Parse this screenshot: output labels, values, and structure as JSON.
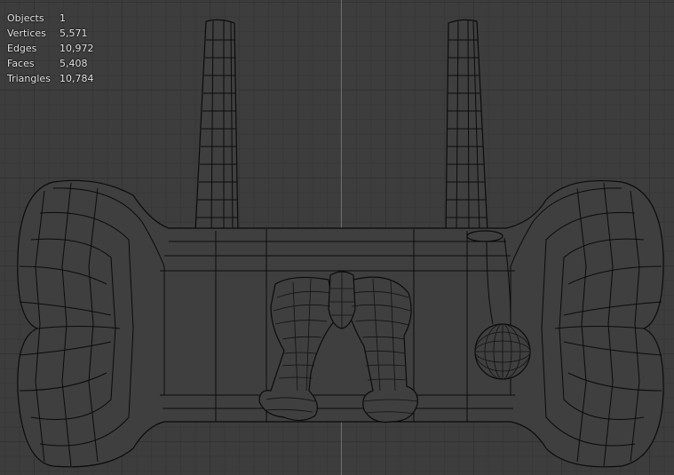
{
  "stats": [
    {
      "label": "Objects",
      "value": "1"
    },
    {
      "label": "Vertices",
      "value": "5,571"
    },
    {
      "label": "Edges",
      "value": "10,972"
    },
    {
      "label": "Faces",
      "value": "5,408"
    },
    {
      "label": "Triangles",
      "value": "10,784"
    }
  ],
  "colors": {
    "viewport_bg": "#3d3d3d",
    "grid": "#333333",
    "axis": "#4a76b8",
    "wire": "#0b0b0b"
  }
}
